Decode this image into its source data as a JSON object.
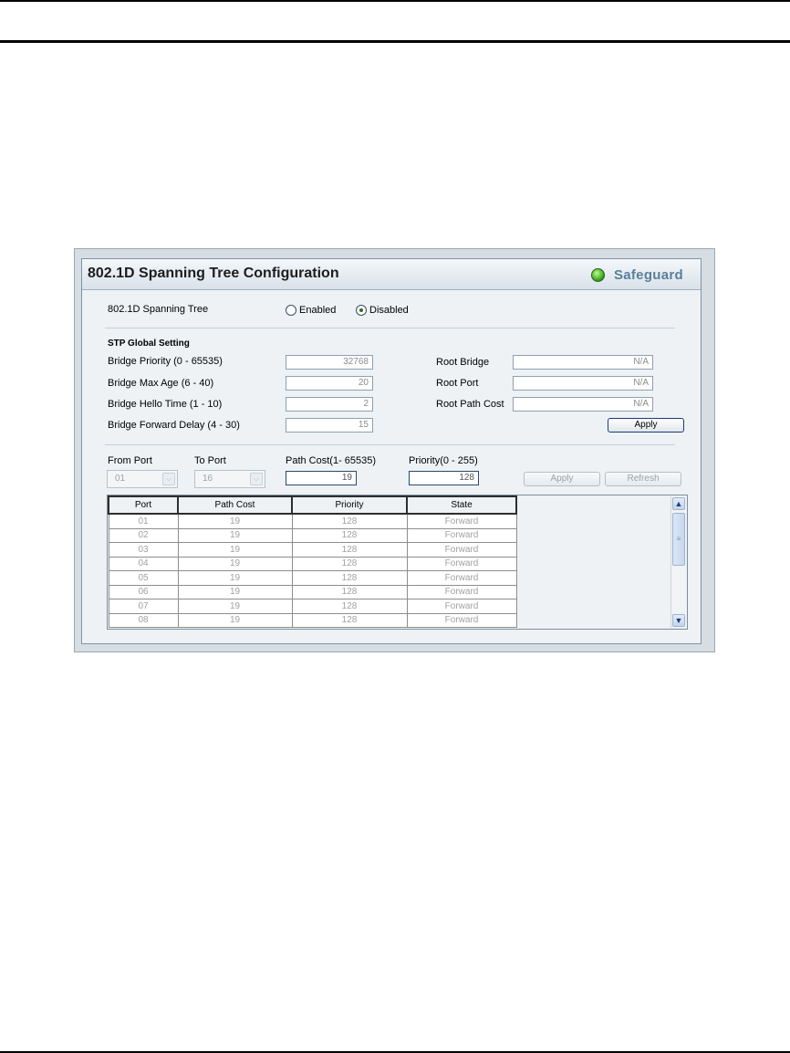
{
  "panel": {
    "title": "802.1D Spanning Tree Configuration",
    "badge": "Safeguard"
  },
  "stp": {
    "label": "802.1D Spanning Tree",
    "options": [
      "Enabled",
      "Disabled"
    ],
    "selected": "Disabled"
  },
  "global": {
    "heading": "STP Global Setting",
    "bridge_priority": {
      "label": "Bridge Priority (0 - 65535)",
      "value": "32768"
    },
    "bridge_max_age": {
      "label": "Bridge Max Age (6 - 40)",
      "value": "20"
    },
    "bridge_hello_time": {
      "label": "Bridge Hello Time (1 - 10)",
      "value": "2"
    },
    "bridge_forward_delay": {
      "label": "Bridge Forward  Delay (4 - 30)",
      "value": "15"
    },
    "root_bridge": {
      "label": "Root Bridge",
      "value": "N/A"
    },
    "root_port": {
      "label": "Root Port",
      "value": "N/A"
    },
    "root_path_cost": {
      "label": "Root Path Cost",
      "value": "N/A"
    },
    "apply_label": "Apply"
  },
  "port_settings": {
    "from_port": {
      "label": "From Port",
      "value": "01"
    },
    "to_port": {
      "label": "To Port",
      "value": "16"
    },
    "path_cost": {
      "label": "Path Cost(1- 65535)",
      "value": "19"
    },
    "priority": {
      "label": "Priority(0 - 255)",
      "value": "128"
    },
    "apply_label": "Apply",
    "refresh_label": "Refresh"
  },
  "table": {
    "columns": [
      "Port",
      "Path Cost",
      "Priority",
      "State"
    ],
    "rows": [
      [
        "01",
        "19",
        "128",
        "Forward"
      ],
      [
        "02",
        "19",
        "128",
        "Forward"
      ],
      [
        "03",
        "19",
        "128",
        "Forward"
      ],
      [
        "04",
        "19",
        "128",
        "Forward"
      ],
      [
        "05",
        "19",
        "128",
        "Forward"
      ],
      [
        "06",
        "19",
        "128",
        "Forward"
      ],
      [
        "07",
        "19",
        "128",
        "Forward"
      ],
      [
        "08",
        "19",
        "128",
        "Forward"
      ]
    ]
  }
}
